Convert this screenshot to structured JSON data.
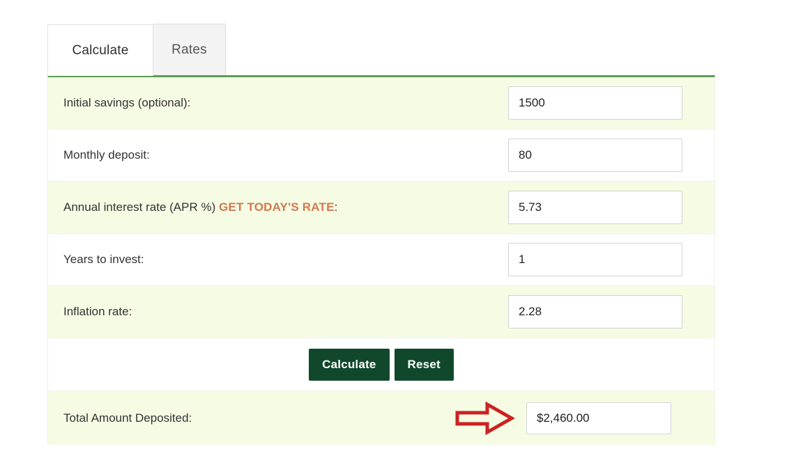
{
  "tabs": [
    {
      "label": "Calculate",
      "active": true
    },
    {
      "label": "Rates",
      "active": false
    }
  ],
  "form": {
    "rows": [
      {
        "label": "Initial savings (optional):",
        "value": "1500",
        "placeholder": "",
        "name": "initial-savings"
      },
      {
        "label": "Monthly deposit:",
        "value": "80",
        "placeholder": "",
        "name": "monthly-deposit"
      },
      {
        "label_prefix": "Annual interest rate (APR %) ",
        "label_link": "GET TODAY'S RATE",
        "label_suffix": ":",
        "value": "5.73",
        "placeholder": "",
        "name": "annual-interest-rate"
      },
      {
        "label": "Years to invest:",
        "value": "1",
        "placeholder": "",
        "name": "years-to-invest"
      },
      {
        "label": "Inflation rate:",
        "value": "2.28",
        "placeholder": "",
        "name": "inflation-rate"
      }
    ]
  },
  "actions": {
    "calculate_label": "Calculate",
    "reset_label": "Reset"
  },
  "result": {
    "label": "Total Amount Deposited:",
    "value": "$2,460.00",
    "annotation_icon": "right-arrow-annotation"
  },
  "colors": {
    "accent_green": "#5a9d53",
    "button_green": "#11482c",
    "link_orange": "#cf7a4e",
    "row_alt_bg": "#f6fbe4",
    "arrow_red": "#cc2222"
  }
}
